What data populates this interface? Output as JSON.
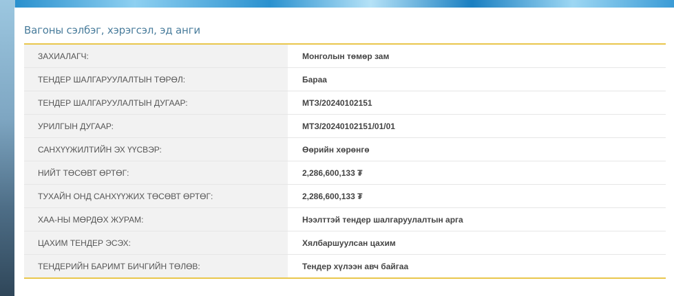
{
  "section": {
    "title": "Вагоны сэлбэг, хэрэгсэл, эд анги"
  },
  "details": [
    {
      "label": "ЗАХИАЛАГЧ:",
      "value": "Монголын төмөр зам"
    },
    {
      "label": "ТЕНДЕР ШАЛГАРУУЛАЛТЫН ТӨРӨЛ:",
      "value": "Бараа"
    },
    {
      "label": "ТЕНДЕР ШАЛГАРУУЛАЛТЫН ДУГААР:",
      "value": "МТЗ/20240102151"
    },
    {
      "label": "УРИЛГЫН ДУГААР:",
      "value": "МТЗ/20240102151/01/01"
    },
    {
      "label": "САНХҮҮЖИЛТИЙН ЭХ ҮҮСВЭР:",
      "value": "Өөрийн хөрөнгө"
    },
    {
      "label": "НИЙТ ТӨСӨВТ ӨРТӨГ:",
      "value": "2,286,600,133 ₮"
    },
    {
      "label": "ТУХАЙН ОНД САНХҮҮЖИХ ТӨСӨВТ ӨРТӨГ:",
      "value": "2,286,600,133 ₮"
    },
    {
      "label": "ХАА-НЫ МӨРДӨХ ЖУРАМ:",
      "value": "Нээлттэй тендер шалгаруулалтын арга"
    },
    {
      "label": "ЦАХИМ ТЕНДЕР ЭСЭХ:",
      "value": "Хялбаршуулсан цахим"
    },
    {
      "label": "ТЕНДЕРИЙН БАРИМТ БИЧГИЙН ТӨЛӨВ:",
      "value": "Тендер хүлээн авч байгаа"
    }
  ],
  "colors": {
    "accent_border": "#e9c64b",
    "title_text": "#4a7d9c",
    "label_bg": "#f2f2f2"
  }
}
